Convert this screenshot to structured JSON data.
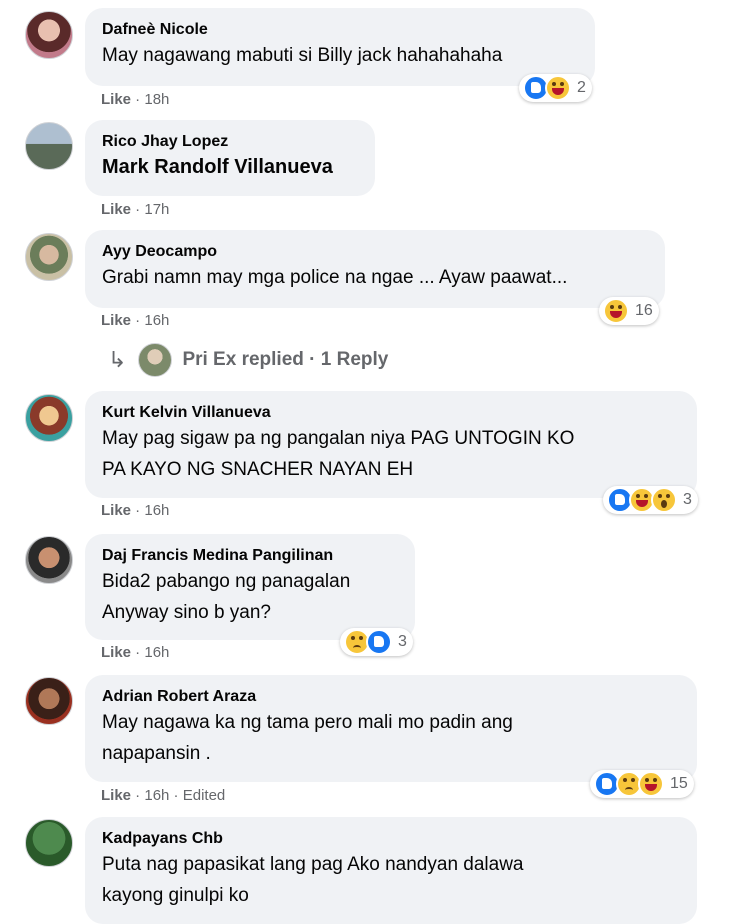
{
  "comments": [
    {
      "author": "Dafneè Nicole",
      "text": [
        "May nagawang mabuti si Billy jack hahahahaha"
      ],
      "like": "Like",
      "time": "18h",
      "edited": "",
      "reaction_count": "2",
      "reactions": [
        "like",
        "haha"
      ]
    },
    {
      "author": "Rico Jhay Lopez",
      "text": [
        "Mark Randolf Villanueva"
      ],
      "like": "Like",
      "time": "17h",
      "edited": "",
      "reaction_count": "",
      "reactions": []
    },
    {
      "author": "Ayy Deocampo",
      "text": [
        "Grabi namn may mga police na ngae ... Ayaw paawat..."
      ],
      "like": "Like",
      "time": "16h",
      "edited": "",
      "reaction_count": "16",
      "reactions": [
        "haha"
      ]
    },
    {
      "author": "Kurt Kelvin Villanueva",
      "text": [
        "May pag sigaw pa ng pangalan niya PAG UNTOGIN KO",
        "PA KAYO NG SNACHER NAYAN EH"
      ],
      "like": "Like",
      "time": "16h",
      "edited": "",
      "reaction_count": "3",
      "reactions": [
        "like",
        "haha",
        "wow"
      ]
    },
    {
      "author": "Daj Francis Medina Pangilinan",
      "text": [
        "Bida2 pabango ng panagalan",
        "Anyway sino b yan?"
      ],
      "like": "Like",
      "time": "16h",
      "edited": "",
      "reaction_count": "3",
      "reactions": [
        "sad",
        "like"
      ]
    },
    {
      "author": "Adrian Robert Araza",
      "text": [
        "May nagawa ka ng tama pero mali mo padin ang",
        "napapansin ."
      ],
      "like": "Like",
      "time": "16h",
      "edited": "Edited",
      "reaction_count": "15",
      "reactions": [
        "like",
        "sad",
        "haha"
      ]
    },
    {
      "author": "Kadpayans Chb",
      "text": [
        "Puta nag papasikat lang pag Ako nandyan dalawa",
        "kayong ginulpi ko"
      ],
      "like": "",
      "time": "",
      "edited": "",
      "reaction_count": "",
      "reactions": []
    }
  ],
  "reply": {
    "arrow": "↳",
    "text": "Pri Ex replied · 1 Reply"
  },
  "meta_sep": " · "
}
